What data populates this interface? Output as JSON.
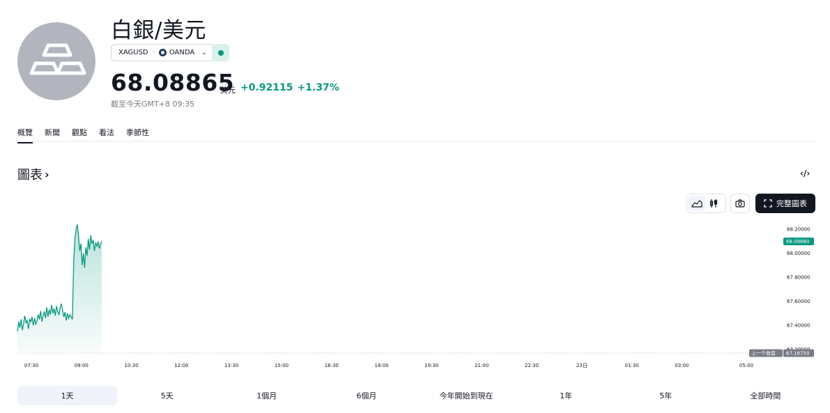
{
  "header": {
    "title": "白銀/美元",
    "symbol": "XAGUSD",
    "exchange": "OANDA",
    "price": "68.08865",
    "currency": "美元",
    "change_abs": "+0.92115",
    "change_pct": "+1.37%",
    "as_of": "截至今天GMT+8 09:35",
    "status": "market-open",
    "logo_icon": "silver-bars-icon"
  },
  "tabs": [
    {
      "label": "概覽",
      "active": true
    },
    {
      "label": "新聞",
      "active": false
    },
    {
      "label": "觀點",
      "active": false
    },
    {
      "label": "看法",
      "active": false
    },
    {
      "label": "季節性",
      "active": false
    }
  ],
  "chart_section": {
    "title": "圖表",
    "embed_icon": "code-embed-icon",
    "tools": {
      "area_icon": "area-chart-icon",
      "candles_icon": "candlestick-icon",
      "camera_icon": "camera-icon",
      "full_chart_label": "完整圖表",
      "full_chart_icon": "fullscreen-icon"
    }
  },
  "colors": {
    "up": "#089981",
    "text": "#131722",
    "muted": "#787b86",
    "prev_close_tag": "#787b86"
  },
  "chart_data": {
    "type": "area",
    "series": [
      {
        "values": [
          67.35,
          67.43,
          67.38,
          67.45,
          67.36,
          67.41,
          67.48,
          67.42,
          67.44,
          67.37,
          67.45,
          67.43,
          67.47,
          67.4,
          67.46,
          67.41,
          67.44,
          67.49,
          67.45,
          67.52,
          67.43,
          67.48,
          67.51,
          67.46,
          67.55,
          67.47,
          67.53,
          67.49,
          67.57,
          67.5,
          67.54,
          67.48,
          67.56,
          67.51,
          67.49,
          67.55,
          67.58,
          67.52,
          67.47,
          67.51,
          67.44,
          67.5,
          67.46,
          67.49,
          67.47,
          67.45,
          67.92,
          68.12,
          68.2,
          68.24,
          68.15,
          68.02,
          68.08,
          67.9,
          68.0,
          67.88,
          68.05,
          67.98,
          68.12,
          68.03,
          68.15,
          68.08,
          68.11,
          68.02,
          68.09,
          68.06,
          68.1,
          68.04,
          68.08,
          68.1
        ]
      }
    ],
    "x_start": "07:00",
    "x_end_of_data": "09:35",
    "x_tick_labels": [
      "07:30",
      "09:00",
      "10:30",
      "12:00",
      "13:30",
      "15:00",
      "16:30",
      "18:00",
      "19:30",
      "21:00",
      "22:30",
      "23日",
      "01:30",
      "03:00",
      "05:00"
    ],
    "y_tick_labels": [
      "68.20000",
      "68.00000",
      "67.80000",
      "67.60000",
      "67.40000",
      "67.20000"
    ],
    "ylim": [
      67.18,
      68.3
    ],
    "last_price": 68.0988,
    "last_price_label": "68.09880",
    "prev_close": 67.1675,
    "prev_close_label": "上一个收盘",
    "prev_close_value_label": "67.16750",
    "grid": false
  },
  "ranges": [
    {
      "label": "1天",
      "active": true
    },
    {
      "label": "5天",
      "active": false
    },
    {
      "label": "1個月",
      "active": false
    },
    {
      "label": "6個月",
      "active": false
    },
    {
      "label": "今年開始到現在",
      "active": false
    },
    {
      "label": "1年",
      "active": false
    },
    {
      "label": "5年",
      "active": false
    },
    {
      "label": "全部時間",
      "active": false
    }
  ]
}
